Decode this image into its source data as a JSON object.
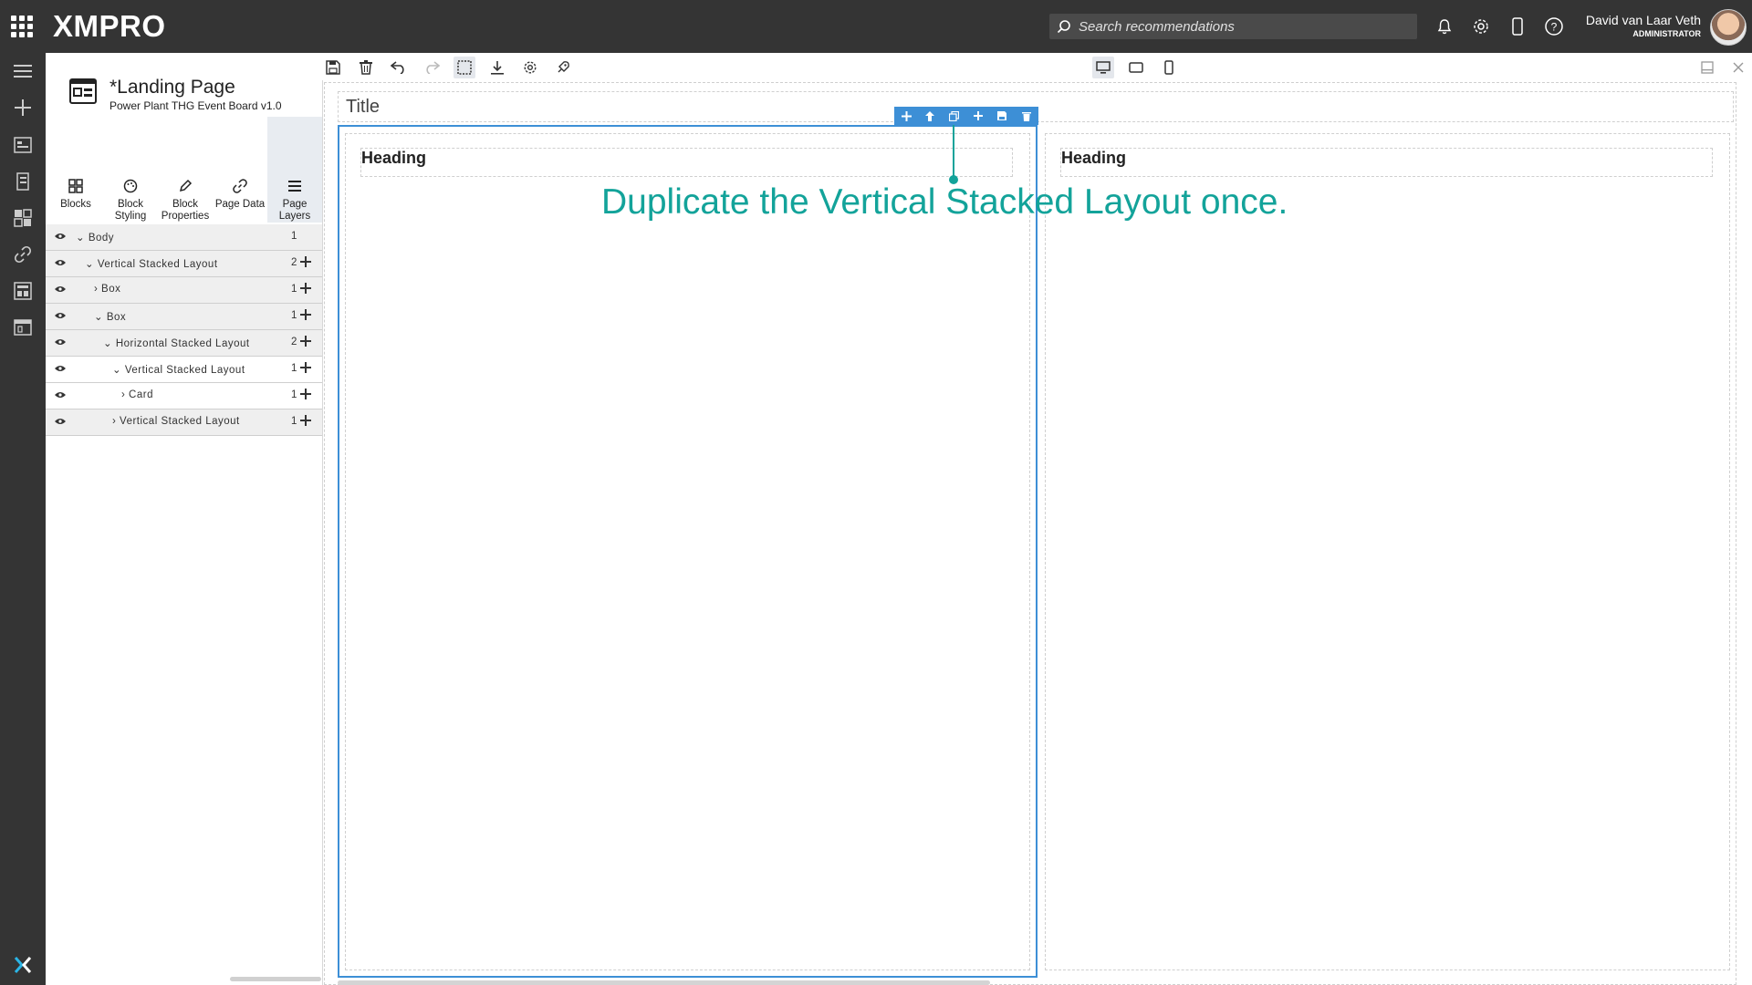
{
  "app": {
    "logo": "XMPRO",
    "search_placeholder": "Search recommendations",
    "user": {
      "name": "David van Laar Veth",
      "role": "ADMINISTRATOR"
    }
  },
  "page": {
    "title": "*Landing Page",
    "subtitle": "Power Plant THG Event Board v1.0"
  },
  "panel_tabs": [
    {
      "label": "Blocks",
      "icon": "blocks-icon"
    },
    {
      "label": "Block Styling",
      "icon": "palette-icon"
    },
    {
      "label": "Block Properties",
      "icon": "pencil-icon"
    },
    {
      "label": "Page Data",
      "icon": "link-icon"
    },
    {
      "label": "Page Layers",
      "icon": "layers-icon",
      "active": true
    }
  ],
  "layers": [
    {
      "name": "Body",
      "count": "1",
      "indent": 0,
      "expanded": true
    },
    {
      "name": "Vertical Stacked Layout",
      "count": "2",
      "indent": 1,
      "expanded": true
    },
    {
      "name": "Box",
      "count": "1",
      "indent": 2,
      "expanded": false
    },
    {
      "name": "Box",
      "count": "1",
      "indent": 2,
      "expanded": true
    },
    {
      "name": "Horizontal Stacked Layout",
      "count": "2",
      "indent": 3,
      "expanded": true
    },
    {
      "name": "Vertical Stacked Layout",
      "count": "1",
      "indent": 4,
      "expanded": true
    },
    {
      "name": "Card",
      "count": "1",
      "indent": 5,
      "expanded": false
    },
    {
      "name": "Vertical Stacked Layout",
      "count": "1",
      "indent": 4,
      "expanded": false
    }
  ],
  "canvas": {
    "title": "Title",
    "left_heading": "Heading",
    "right_heading": "Heading"
  },
  "annotation": "Duplicate the Vertical Stacked Layout once.",
  "colors": {
    "accent": "#3d8fd6",
    "annotation": "#13a39a",
    "topbar": "#343434"
  }
}
